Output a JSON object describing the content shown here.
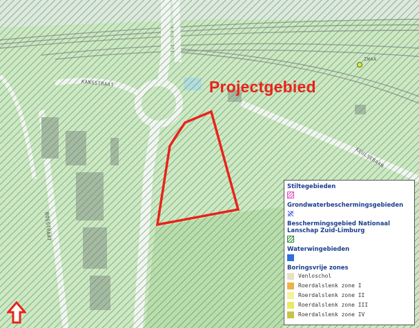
{
  "map": {
    "title_label": "Projectgebied",
    "street_labels": {
      "top": "KANSSTRAAT",
      "left": "BOSSTRAAT",
      "right": "KEULSEBAAN",
      "topright": "ZWAA"
    },
    "colors": {
      "background": "#b9dcb1",
      "hatch": "#2a8a2a",
      "boundary": "#e8231b",
      "title": "#e8231b",
      "road": "#f2f2f2"
    }
  },
  "legend": {
    "groups": [
      {
        "label": "Stiltegebieden",
        "symbol": "pink-hatch"
      },
      {
        "label": "Grondwaterbeschermingsgebieden",
        "symbol": "blue-cross"
      },
      {
        "label": "Beschermingsgebied Nationaal Lanschap Zuid-Limburg",
        "symbol": "green-hatch"
      },
      {
        "label": "Waterwingebieden",
        "symbol": "blue-fill"
      }
    ],
    "boring": {
      "label": "Boringsvrije zones",
      "items": [
        {
          "label": "Venloschol",
          "color": "#e6e1bf"
        },
        {
          "label": "Roerdalslenk zone I",
          "color": "#f0b04a"
        },
        {
          "label": "Roerdalslenk zone II",
          "color": "#f7f199"
        },
        {
          "label": "Roerdalslenk zone III",
          "color": "#e7ec5e"
        },
        {
          "label": "Roerdalslenk zone IV",
          "color": "#c8c24a"
        }
      ]
    }
  }
}
